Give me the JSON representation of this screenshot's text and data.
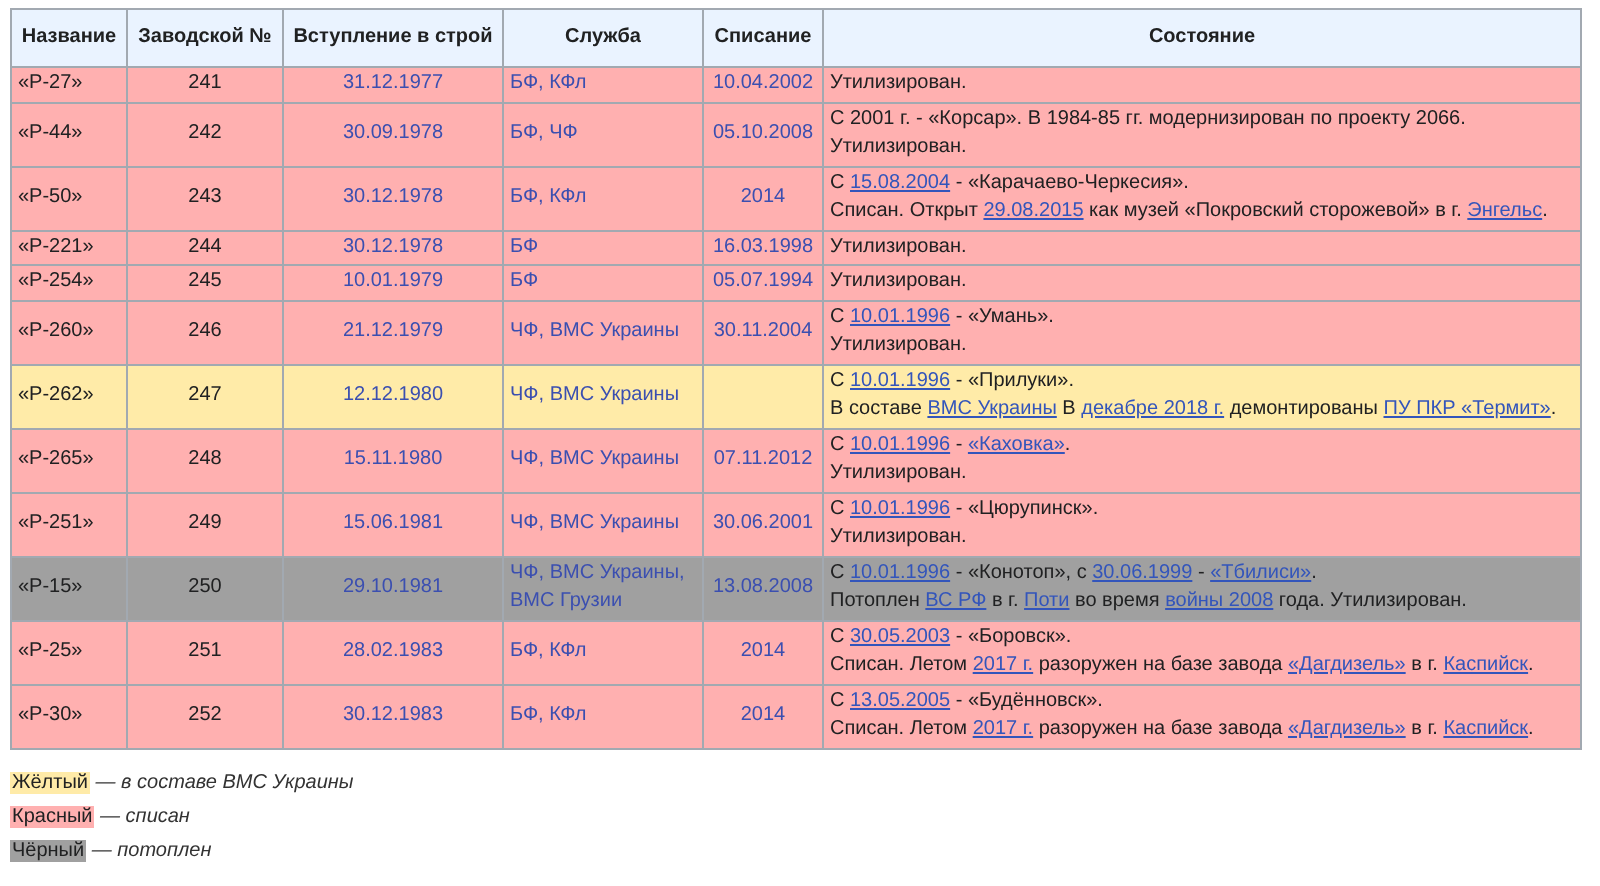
{
  "table": {
    "columns": [
      "Название",
      "Заводской №",
      "Вступление в строй",
      "Служба",
      "Списание",
      "Состояние"
    ],
    "rows": [
      {
        "kind": "scrapped",
        "name": "«Р-27»",
        "number": "241",
        "commissioned": "31.12.1977",
        "service": "БФ, КФл",
        "decommissioned": "10.04.2002",
        "state": [
          [
            "Утилизирован."
          ]
        ]
      },
      {
        "kind": "scrapped",
        "name": "«Р-44»",
        "number": "242",
        "commissioned": "30.09.1978",
        "service": "БФ, ЧФ",
        "decommissioned": "05.10.2008",
        "state": [
          [
            "С 2001 г. - «Корсар». В 1984-85 гг. модернизирован по проекту 2066."
          ],
          [
            "Утилизирован."
          ]
        ]
      },
      {
        "kind": "scrapped",
        "name": "«Р-50»",
        "number": "243",
        "commissioned": "30.12.1978",
        "service": "БФ, КФл",
        "decommissioned": "2014",
        "state": [
          [
            "С ",
            {
              "link": "15.08.2004"
            },
            " - «Карачаево-Черкесия»."
          ],
          [
            "Списан. Открыт ",
            {
              "link": "29.08.2015"
            },
            " как музей «Покровский сторожевой» в г. ",
            {
              "link": "Энгельс"
            },
            "."
          ]
        ]
      },
      {
        "kind": "scrapped",
        "name": "«Р-221»",
        "number": "244",
        "commissioned": "30.12.1978",
        "service": "БФ",
        "decommissioned": "16.03.1998",
        "state": [
          [
            "Утилизирован."
          ]
        ]
      },
      {
        "kind": "scrapped",
        "name": "«Р-254»",
        "number": "245",
        "commissioned": "10.01.1979",
        "service": "БФ",
        "decommissioned": "05.07.1994",
        "state": [
          [
            "Утилизирован."
          ]
        ]
      },
      {
        "kind": "scrapped",
        "name": "«Р-260»",
        "number": "246",
        "commissioned": "21.12.1979",
        "service": "ЧФ, ВМС Украины",
        "decommissioned": "30.11.2004",
        "state": [
          [
            "С ",
            {
              "link": "10.01.1996"
            },
            " - «Умань»."
          ],
          [
            "Утилизирован."
          ]
        ]
      },
      {
        "kind": "active",
        "name": "«Р-262»",
        "number": "247",
        "commissioned": "12.12.1980",
        "service": "ЧФ, ВМС Украины",
        "state": [
          [
            "С ",
            {
              "link": "10.01.1996"
            },
            " - «Прилуки»."
          ],
          [
            "В составе ",
            {
              "link": "ВМС Украины"
            },
            " В ",
            {
              "link": "декабре 2018 г."
            },
            " демонтированы ",
            {
              "link": "ПУ ПКР «Термит»"
            },
            "."
          ]
        ]
      },
      {
        "kind": "scrapped",
        "name": "«Р-265»",
        "number": "248",
        "commissioned": "15.11.1980",
        "service": "ЧФ, ВМС Украины",
        "decommissioned": "07.11.2012",
        "state": [
          [
            "С ",
            {
              "link": "10.01.1996"
            },
            " - ",
            {
              "link": "«Каховка»"
            },
            "."
          ],
          [
            "Утилизирован."
          ]
        ]
      },
      {
        "kind": "scrapped",
        "name": "«Р-251»",
        "number": "249",
        "commissioned": "15.06.1981",
        "service": "ЧФ, ВМС Украины",
        "decommissioned": "30.06.2001",
        "state": [
          [
            "С ",
            {
              "link": "10.01.1996"
            },
            " - «Цюрупинск»."
          ],
          [
            "Утилизирован."
          ]
        ]
      },
      {
        "kind": "sunk",
        "name": "«Р-15»",
        "number": "250",
        "commissioned": "29.10.1981",
        "service": "ЧФ, ВМС Украины, ВМС Грузии",
        "decommissioned": "13.08.2008",
        "state": [
          [
            "С ",
            {
              "link": "10.01.1996"
            },
            " - «Конотоп», с ",
            {
              "link": "30.06.1999"
            },
            " - ",
            {
              "link": "«Тбилиси»"
            },
            "."
          ],
          [
            "Потоплен ",
            {
              "link": "ВС РФ"
            },
            " в г. ",
            {
              "link": "Поти"
            },
            " во время ",
            {
              "link": "войны 2008"
            },
            " года. Утилизирован."
          ]
        ]
      },
      {
        "kind": "scrapped",
        "name": "«Р-25»",
        "number": "251",
        "commissioned": "28.02.1983",
        "service": "БФ, КФл",
        "decommissioned": "2014",
        "state": [
          [
            "С ",
            {
              "link": "30.05.2003"
            },
            " - «Боровск»."
          ],
          [
            "Списан. Летом ",
            {
              "link": "2017 г."
            },
            " разоружен на базе завода ",
            {
              "link": "«Дагдизель»"
            },
            " в г. ",
            {
              "link": "Каспийск"
            },
            "."
          ]
        ]
      },
      {
        "kind": "scrapped",
        "name": "«Р-30»",
        "number": "252",
        "commissioned": "30.12.1983",
        "service": "БФ, КФл",
        "decommissioned": "2014",
        "state": [
          [
            "С ",
            {
              "link": "13.05.2005"
            },
            " - «Будённовск»."
          ],
          [
            "Списан. Летом ",
            {
              "link": "2017 г."
            },
            " разоружен на базе завода ",
            {
              "link": "«Дагдизель»"
            },
            " в г. ",
            {
              "link": "Каспийск"
            },
            "."
          ]
        ]
      }
    ]
  },
  "legend": [
    {
      "kind": "active",
      "label": "Жёлтый",
      "description": "— в составе ВМС Украины"
    },
    {
      "kind": "scrapped",
      "label": "Красный",
      "description": "— списан"
    },
    {
      "kind": "sunk",
      "label": "Чёрный",
      "description": "— потоплен"
    }
  ]
}
